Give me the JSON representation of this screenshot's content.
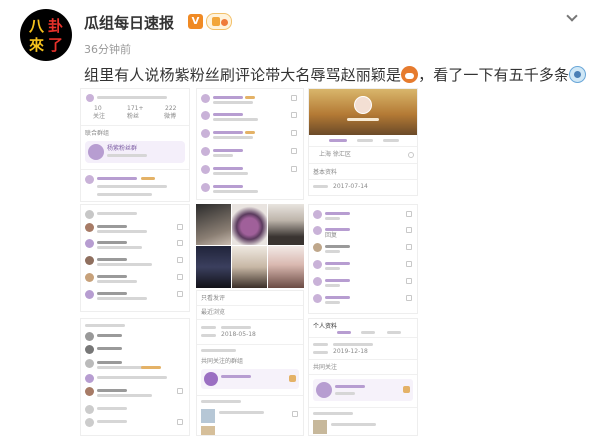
{
  "post": {
    "author": "瓜组每日速报",
    "time": "36分钟前",
    "text": "组里有人说杨紫粉丝刷评论带大名辱骂赵丽颖是",
    "text_tail": "，看了一下有五千多条",
    "avatar_glyphs": [
      "八",
      "卦",
      "來",
      "了"
    ]
  },
  "screens": {
    "left_top_tabs": [
      "10",
      "171+",
      "222"
    ],
    "tab_labels": [
      "关注",
      "粉丝",
      "微博"
    ],
    "group_label": "联合群组",
    "group_name": "杨紫粉丝群",
    "comment_tag": "杨紫",
    "profile_location": "上海  徐汇区",
    "profile_section": "基本资料",
    "profile_date": "2017-07-14",
    "replies_label": "回复",
    "mid_section": "只看发评",
    "mid_tab": "最近浏览",
    "mid_section2": "共同关注的群组",
    "mid_date": "2018-05-18",
    "right_section": "个人资料",
    "right_date": "2019-12-18",
    "right_sub": "共同关注",
    "share_label": "微博"
  },
  "colors": {
    "accent_purple": "#b79dd1",
    "accent_gold": "#e4b267",
    "vip": "#f08a24"
  },
  "icons": [
    "chevron-down-icon",
    "vip-badge-icon",
    "fans-badge-icon",
    "fox-emoji-icon",
    "surprised-emoji-icon"
  ]
}
